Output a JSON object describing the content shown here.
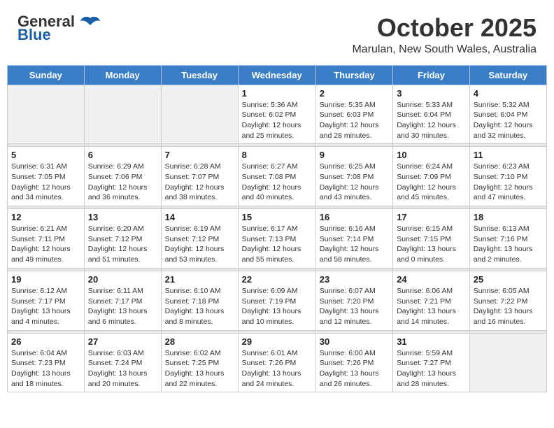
{
  "header": {
    "logo_line1": "General",
    "logo_line2": "Blue",
    "month": "October 2025",
    "location": "Marulan, New South Wales, Australia"
  },
  "days_of_week": [
    "Sunday",
    "Monday",
    "Tuesday",
    "Wednesday",
    "Thursday",
    "Friday",
    "Saturday"
  ],
  "weeks": [
    [
      {
        "num": "",
        "info": ""
      },
      {
        "num": "",
        "info": ""
      },
      {
        "num": "",
        "info": ""
      },
      {
        "num": "1",
        "info": "Sunrise: 5:36 AM\nSunset: 6:02 PM\nDaylight: 12 hours\nand 25 minutes."
      },
      {
        "num": "2",
        "info": "Sunrise: 5:35 AM\nSunset: 6:03 PM\nDaylight: 12 hours\nand 28 minutes."
      },
      {
        "num": "3",
        "info": "Sunrise: 5:33 AM\nSunset: 6:04 PM\nDaylight: 12 hours\nand 30 minutes."
      },
      {
        "num": "4",
        "info": "Sunrise: 5:32 AM\nSunset: 6:04 PM\nDaylight: 12 hours\nand 32 minutes."
      }
    ],
    [
      {
        "num": "5",
        "info": "Sunrise: 6:31 AM\nSunset: 7:05 PM\nDaylight: 12 hours\nand 34 minutes."
      },
      {
        "num": "6",
        "info": "Sunrise: 6:29 AM\nSunset: 7:06 PM\nDaylight: 12 hours\nand 36 minutes."
      },
      {
        "num": "7",
        "info": "Sunrise: 6:28 AM\nSunset: 7:07 PM\nDaylight: 12 hours\nand 38 minutes."
      },
      {
        "num": "8",
        "info": "Sunrise: 6:27 AM\nSunset: 7:08 PM\nDaylight: 12 hours\nand 40 minutes."
      },
      {
        "num": "9",
        "info": "Sunrise: 6:25 AM\nSunset: 7:08 PM\nDaylight: 12 hours\nand 43 minutes."
      },
      {
        "num": "10",
        "info": "Sunrise: 6:24 AM\nSunset: 7:09 PM\nDaylight: 12 hours\nand 45 minutes."
      },
      {
        "num": "11",
        "info": "Sunrise: 6:23 AM\nSunset: 7:10 PM\nDaylight: 12 hours\nand 47 minutes."
      }
    ],
    [
      {
        "num": "12",
        "info": "Sunrise: 6:21 AM\nSunset: 7:11 PM\nDaylight: 12 hours\nand 49 minutes."
      },
      {
        "num": "13",
        "info": "Sunrise: 6:20 AM\nSunset: 7:12 PM\nDaylight: 12 hours\nand 51 minutes."
      },
      {
        "num": "14",
        "info": "Sunrise: 6:19 AM\nSunset: 7:12 PM\nDaylight: 12 hours\nand 53 minutes."
      },
      {
        "num": "15",
        "info": "Sunrise: 6:17 AM\nSunset: 7:13 PM\nDaylight: 12 hours\nand 55 minutes."
      },
      {
        "num": "16",
        "info": "Sunrise: 6:16 AM\nSunset: 7:14 PM\nDaylight: 12 hours\nand 58 minutes."
      },
      {
        "num": "17",
        "info": "Sunrise: 6:15 AM\nSunset: 7:15 PM\nDaylight: 13 hours\nand 0 minutes."
      },
      {
        "num": "18",
        "info": "Sunrise: 6:13 AM\nSunset: 7:16 PM\nDaylight: 13 hours\nand 2 minutes."
      }
    ],
    [
      {
        "num": "19",
        "info": "Sunrise: 6:12 AM\nSunset: 7:17 PM\nDaylight: 13 hours\nand 4 minutes."
      },
      {
        "num": "20",
        "info": "Sunrise: 6:11 AM\nSunset: 7:17 PM\nDaylight: 13 hours\nand 6 minutes."
      },
      {
        "num": "21",
        "info": "Sunrise: 6:10 AM\nSunset: 7:18 PM\nDaylight: 13 hours\nand 8 minutes."
      },
      {
        "num": "22",
        "info": "Sunrise: 6:09 AM\nSunset: 7:19 PM\nDaylight: 13 hours\nand 10 minutes."
      },
      {
        "num": "23",
        "info": "Sunrise: 6:07 AM\nSunset: 7:20 PM\nDaylight: 13 hours\nand 12 minutes."
      },
      {
        "num": "24",
        "info": "Sunrise: 6:06 AM\nSunset: 7:21 PM\nDaylight: 13 hours\nand 14 minutes."
      },
      {
        "num": "25",
        "info": "Sunrise: 6:05 AM\nSunset: 7:22 PM\nDaylight: 13 hours\nand 16 minutes."
      }
    ],
    [
      {
        "num": "26",
        "info": "Sunrise: 6:04 AM\nSunset: 7:23 PM\nDaylight: 13 hours\nand 18 minutes."
      },
      {
        "num": "27",
        "info": "Sunrise: 6:03 AM\nSunset: 7:24 PM\nDaylight: 13 hours\nand 20 minutes."
      },
      {
        "num": "28",
        "info": "Sunrise: 6:02 AM\nSunset: 7:25 PM\nDaylight: 13 hours\nand 22 minutes."
      },
      {
        "num": "29",
        "info": "Sunrise: 6:01 AM\nSunset: 7:26 PM\nDaylight: 13 hours\nand 24 minutes."
      },
      {
        "num": "30",
        "info": "Sunrise: 6:00 AM\nSunset: 7:26 PM\nDaylight: 13 hours\nand 26 minutes."
      },
      {
        "num": "31",
        "info": "Sunrise: 5:59 AM\nSunset: 7:27 PM\nDaylight: 13 hours\nand 28 minutes."
      },
      {
        "num": "",
        "info": ""
      }
    ]
  ]
}
